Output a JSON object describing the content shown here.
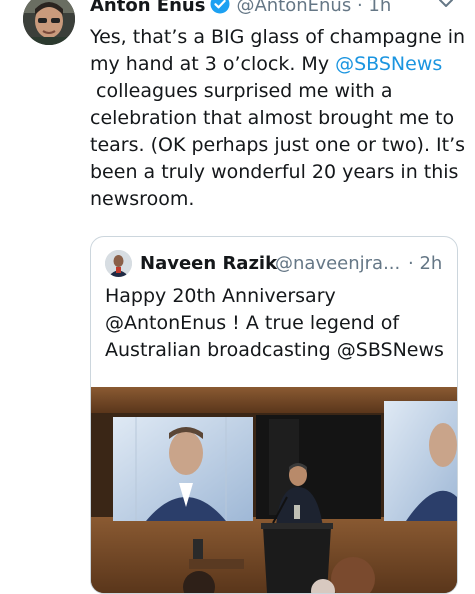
{
  "tweet": {
    "author": {
      "name": "Anton Enus",
      "handle": "@AntonEnus",
      "verified_icon": "verified-badge-icon"
    },
    "separator": "·",
    "time": "1h",
    "menu_icon": "chevron-down-icon",
    "text": {
      "line1": "Yes, that’s a BIG glass of champagne in",
      "line2_before": "my hand at 3 o’clock. My ",
      "mention": "@SBSNews",
      "line3": "colleagues surprised me with a",
      "line4": "celebration that almost brought me to",
      "line5": "tears. (OK perhaps just one or two). It’s",
      "line6": "been a truly wonderful 20 years in this",
      "line7": "newsroom."
    }
  },
  "quoted_tweet": {
    "author": {
      "name": "Naveen Razik",
      "handle": "@naveenjra..."
    },
    "separator": "·",
    "time": "2h",
    "text": {
      "line1": "Happy 20th Anniversary",
      "line2": "@AntonEnus ! A true legend of",
      "line3": "Australian broadcasting @SBSNews"
    },
    "photo_icon": "event-photo-image"
  },
  "colors": {
    "link": "#1b95e0",
    "secondary": "#657786",
    "verified": "#1da1f2",
    "border": "#ccd6dd"
  }
}
